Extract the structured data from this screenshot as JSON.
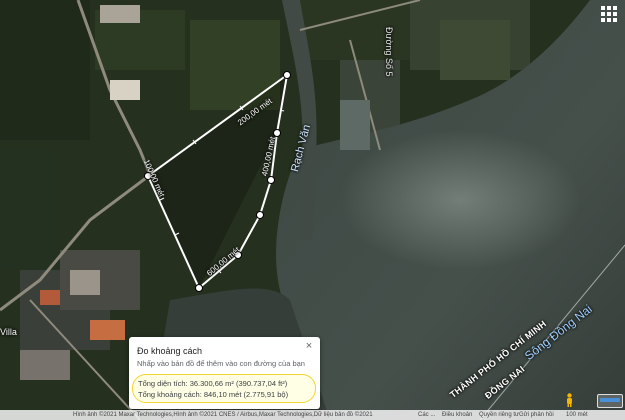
{
  "map": {
    "labels": {
      "road": "Đường Số 5",
      "canal": "Rạch Văn",
      "river": "Sông Đồng Nai",
      "city": "THÀNH PHỐ HỒ CHÍ MINH",
      "province": "ĐỒNG NAI",
      "place": "Villa"
    },
    "segments": {
      "top": "200,00 mét",
      "left": "100,00 mét",
      "right": "400,00 mét",
      "bottom": "600,00 mét"
    }
  },
  "measure": {
    "title": "Đo khoảng cách",
    "hint": "Nhấp vào bản đồ để thêm vào con đường của bạn",
    "close": "×",
    "area": "Tổng diện tích: 36.300,66 m² (390.737,04 ft²)",
    "distance": "Tổng khoảng cách: 846,10 mét (2.775,91 bộ)"
  },
  "footer": {
    "attribution": "Hình ảnh ©2021 Maxar Technologies,Hình ảnh ©2021 CNES / Airbus,Maxar Technologies,Dữ liệu bản đồ ©2021",
    "links": [
      "Các ...",
      "Điều khoản",
      "Quyền riêng tư",
      "Gửi phản hồi",
      "100 mét"
    ]
  },
  "colors": {
    "measure_line": "#ffffff",
    "highlight": "#f5d432",
    "water": "#3a4440",
    "land": "#2f3a26"
  }
}
